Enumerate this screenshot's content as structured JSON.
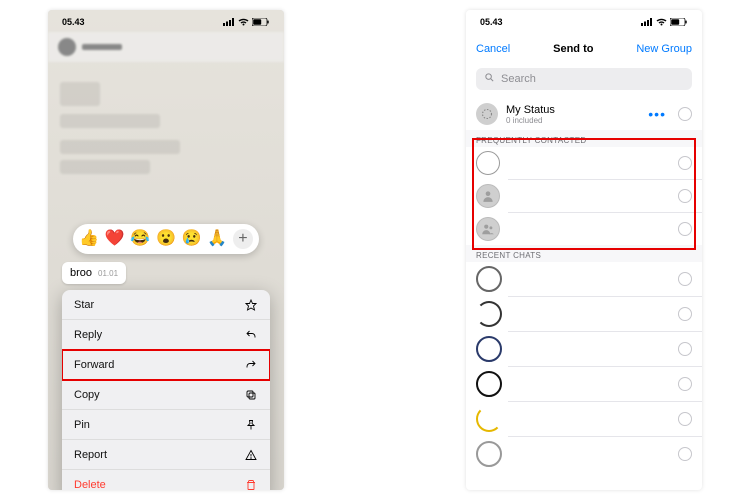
{
  "status": {
    "time": "05.43"
  },
  "phoneA": {
    "reactions": {
      "r1": "👍",
      "r2": "❤️",
      "r3": "😂",
      "r4": "😮",
      "r5": "😢",
      "r6": "🙏"
    },
    "message": {
      "text": "broo",
      "time": "01.01"
    },
    "menu": {
      "star": "Star",
      "reply": "Reply",
      "forward": "Forward",
      "copy": "Copy",
      "pin": "Pin",
      "report": "Report",
      "delete": "Delete"
    }
  },
  "phoneB": {
    "nav": {
      "cancel": "Cancel",
      "title": "Send to",
      "newgroup": "New Group"
    },
    "search": {
      "placeholder": "Search"
    },
    "mystatus": {
      "title": "My Status",
      "subtitle": "0 included",
      "dots": "•••"
    },
    "sections": {
      "freq": "FREQUENTLY CONTACTED",
      "recent": "RECENT CHATS"
    }
  }
}
